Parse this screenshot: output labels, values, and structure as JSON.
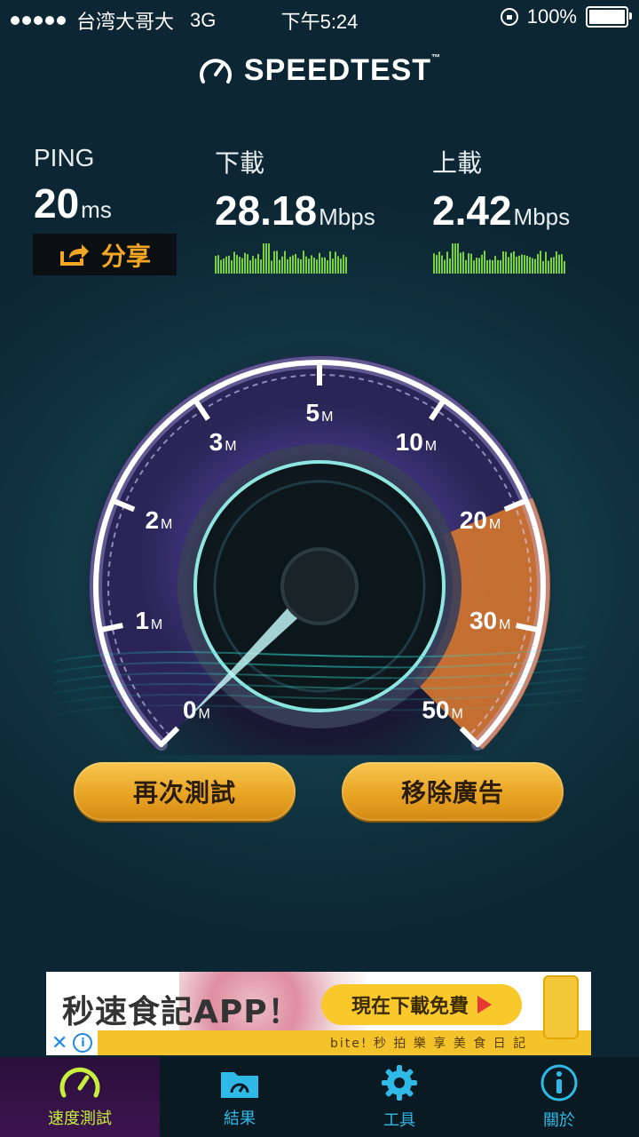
{
  "status_bar": {
    "carrier": "台湾大哥大",
    "network": "3G",
    "time": "下午5:24",
    "battery": "100%"
  },
  "app": {
    "title": "SPEEDTEST",
    "trademark": "™"
  },
  "ping": {
    "label": "PING",
    "value": "20",
    "unit": "ms"
  },
  "download": {
    "label": "下載",
    "value": "28.18",
    "unit": "Mbps"
  },
  "upload": {
    "label": "上載",
    "value": "2.42",
    "unit": "Mbps"
  },
  "share_label": "分享",
  "gauge": {
    "ticks": [
      {
        "n": "0",
        "u": "M"
      },
      {
        "n": "1",
        "u": "M"
      },
      {
        "n": "2",
        "u": "M"
      },
      {
        "n": "3",
        "u": "M"
      },
      {
        "n": "5",
        "u": "M"
      },
      {
        "n": "10",
        "u": "M"
      },
      {
        "n": "20",
        "u": "M"
      },
      {
        "n": "30",
        "u": "M"
      },
      {
        "n": "50",
        "u": "M"
      }
    ],
    "needle_value_mbps": 0,
    "highlight_from_mbps": 20,
    "highlight_to_mbps": 50,
    "colors": {
      "ring": "#ffffff",
      "track": "#4b3a84",
      "highlight": "#e07b2b",
      "needle": "#bff3f3"
    }
  },
  "buttons": {
    "retest": "再次測試",
    "remove_ads": "移除廣告"
  },
  "ad": {
    "headline": "秒速食記APP！",
    "cta": "現在下載免費",
    "footer": "bite! 秒 拍 樂 享 美 食 日 記",
    "close_glyph": "✕",
    "info_glyph": "i"
  },
  "tabs": [
    {
      "label": "速度測試",
      "icon": "speedometer-icon",
      "active": true
    },
    {
      "label": "結果",
      "icon": "folder-gauge-icon",
      "active": false
    },
    {
      "label": "工具",
      "icon": "gear-icon",
      "active": false
    },
    {
      "label": "關於",
      "icon": "info-icon",
      "active": false
    }
  ]
}
